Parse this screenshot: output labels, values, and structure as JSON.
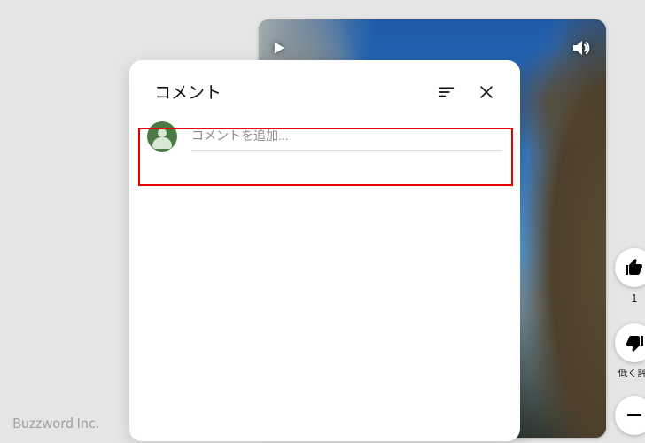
{
  "footer": {
    "brand": "Buzzword Inc."
  },
  "video": {
    "controls": {
      "play_icon": "play-icon",
      "volume_icon": "volume-icon"
    }
  },
  "action_rail": {
    "like": {
      "icon": "thumb-up-icon",
      "count": "1"
    },
    "dislike": {
      "icon": "thumb-down-icon",
      "label": "低く評"
    },
    "more": {
      "icon": "dots-icon"
    }
  },
  "comment_panel": {
    "title": "コメント",
    "sort_icon": "sort-icon",
    "close_icon": "close-icon",
    "input": {
      "placeholder": "コメントを追加..."
    }
  }
}
